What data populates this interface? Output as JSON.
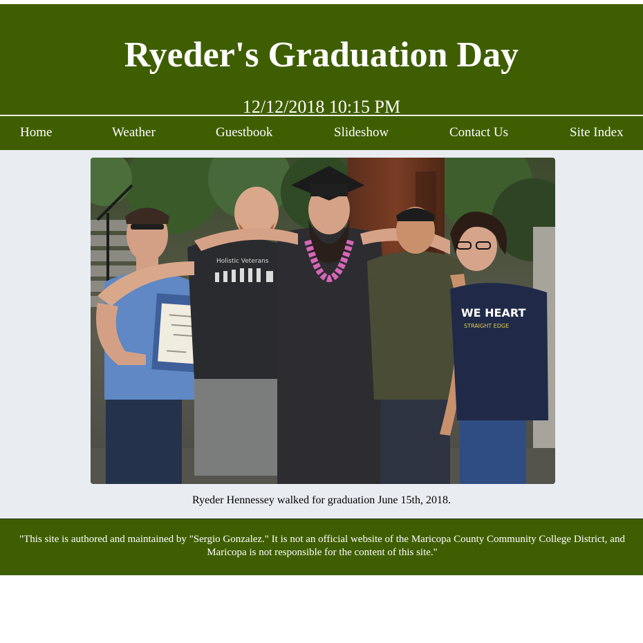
{
  "header": {
    "title": "Ryeder's Graduation Day",
    "datetime": "12/12/2018 10:15 PM"
  },
  "nav": {
    "items": [
      {
        "label": "Home"
      },
      {
        "label": "Weather"
      },
      {
        "label": "Guestbook"
      },
      {
        "label": "Slideshow"
      },
      {
        "label": "Contact Us"
      },
      {
        "label": "Site Index"
      }
    ]
  },
  "main": {
    "caption": "Ryeder Hennessey walked for graduation June 15th, 2018.",
    "photo": {
      "shirt_text_1": "Holistic Veterans",
      "shirt_text_2": "WE HEART",
      "shirt_text_3": "STRAIGHT EDGE"
    }
  },
  "footer": {
    "disclaimer": "\"This site is authored and maintained by \"Sergio Gonzalez.\" It is not an official website of the Maricopa County Community College District, and Maricopa is not responsible for the content of this site.\""
  },
  "colors": {
    "brand_green": "#3f5e02",
    "content_bg": "#e9ecf0",
    "text_on_brand": "#ffffff"
  }
}
